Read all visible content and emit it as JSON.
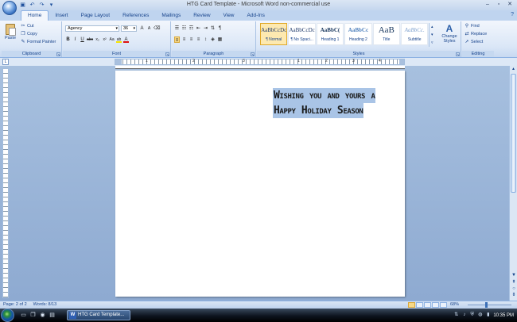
{
  "window": {
    "title": "HTG Card Template - Microsoft Word non-commercial use",
    "quick_access": [
      "save-icon",
      "undo-icon",
      "redo-icon",
      "customize-icon"
    ],
    "controls": {
      "minimize": "–",
      "maximize": "▫",
      "close": "✕"
    }
  },
  "tabs": [
    "Home",
    "Insert",
    "Page Layout",
    "References",
    "Mailings",
    "Review",
    "View",
    "Add-Ins"
  ],
  "active_tab": "Home",
  "ribbon": {
    "clipboard": {
      "label": "Clipboard",
      "paste": "Paste",
      "cut": "Cut",
      "copy": "Copy",
      "format_painter": "Format Painter"
    },
    "font": {
      "label": "Font",
      "font_name": "Agency",
      "font_size": "36",
      "grow": "A",
      "shrink": "A",
      "clear": "⌫",
      "bold": "B",
      "italic": "I",
      "underline": "U",
      "strike": "abc",
      "subscript": "x₂",
      "superscript": "x²",
      "change_case": "Aa",
      "highlight": "ab",
      "font_color": "A"
    },
    "paragraph": {
      "label": "Paragraph"
    },
    "styles": {
      "label": "Styles",
      "items": [
        {
          "sample": "AaBbCcDc",
          "name": "¶ Normal"
        },
        {
          "sample": "AaBbCcDc",
          "name": "¶ No Spaci..."
        },
        {
          "sample": "AaBbC(",
          "name": "Heading 1"
        },
        {
          "sample": "AaBbCc",
          "name": "Heading 2"
        },
        {
          "sample": "AaB",
          "name": "Title"
        },
        {
          "sample": "AaBbCc.",
          "name": "Subtitle"
        }
      ],
      "change_styles": "Change Styles"
    },
    "editing": {
      "label": "Editing",
      "find": "Find",
      "replace": "Replace",
      "select": "Select"
    }
  },
  "ruler": {
    "numbers": [
      "1",
      "2",
      "3",
      "1",
      "2",
      "3",
      "4"
    ]
  },
  "document": {
    "lines": [
      "Wishing you and yours a",
      "Happy Holiday Season"
    ]
  },
  "status": {
    "page": "Page: 2 of 2",
    "words": "Words: 8/13",
    "zoom": "68%"
  },
  "taskbar": {
    "task_label": "HTG Card Template...",
    "clock": "10:35 PM"
  }
}
